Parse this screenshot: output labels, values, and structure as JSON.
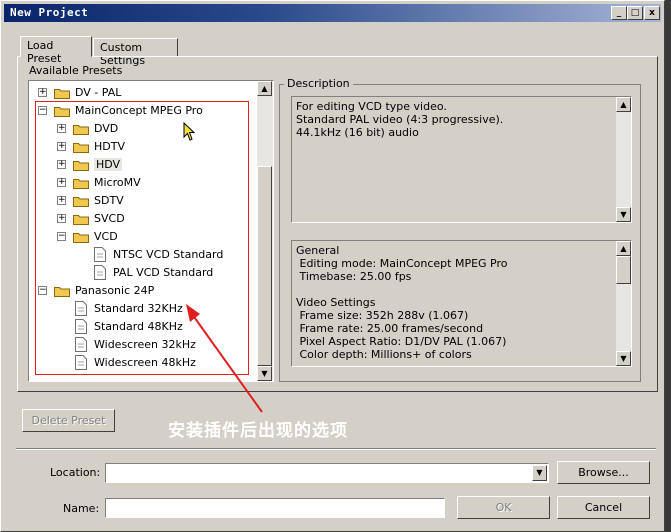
{
  "window": {
    "title": "New Project"
  },
  "title_buttons": {
    "minimize": "_",
    "maximize": "□",
    "close": "x"
  },
  "tabs": [
    {
      "label": "Load Preset"
    },
    {
      "label": "Custom Settings"
    }
  ],
  "available_presets_label": "Available Presets",
  "tree": [
    {
      "label": "DV - PAL",
      "type": "folder",
      "expander": "+"
    },
    {
      "label": "MainConcept MPEG Pro",
      "type": "folder",
      "expander": "−"
    },
    {
      "label": "DVD",
      "type": "folder",
      "expander": "+"
    },
    {
      "label": "HDTV",
      "type": "folder",
      "expander": "+"
    },
    {
      "label": "HDV",
      "type": "folder",
      "expander": "+",
      "highlighted": true
    },
    {
      "label": "MicroMV",
      "type": "folder",
      "expander": "+"
    },
    {
      "label": "SDTV",
      "type": "folder",
      "expander": "+"
    },
    {
      "label": "SVCD",
      "type": "folder",
      "expander": "+"
    },
    {
      "label": "VCD",
      "type": "folder",
      "expander": "−"
    },
    {
      "label": "NTSC VCD Standard",
      "type": "file"
    },
    {
      "label": "PAL VCD Standard",
      "type": "file"
    },
    {
      "label": "Panasonic 24P",
      "type": "folder",
      "expander": "−"
    },
    {
      "label": "Standard 32KHz",
      "type": "file"
    },
    {
      "label": "Standard 48KHz",
      "type": "file"
    },
    {
      "label": "Widescreen 32kHz",
      "type": "file"
    },
    {
      "label": "Widescreen 48kHz",
      "type": "file"
    }
  ],
  "description": {
    "legend": "Description",
    "lines": [
      "For editing VCD type video.",
      "Standard PAL video (4:3 progressive).",
      "44.1kHz (16 bit) audio"
    ]
  },
  "general": {
    "lines": [
      "General",
      " Editing mode: MainConcept MPEG Pro",
      " Timebase: 25.00 fps",
      "",
      "Video Settings",
      " Frame size: 352h 288v (1.067)",
      " Frame rate: 25.00 frames/second",
      " Pixel Aspect Ratio: D1/DV PAL (1.067)",
      " Color depth: Millions+ of colors"
    ]
  },
  "buttons": {
    "delete_preset": "Delete Preset",
    "browse": "Browse...",
    "ok": "OK",
    "cancel": "Cancel"
  },
  "fields": {
    "location_label": "Location:",
    "location_value": "",
    "name_label": "Name:",
    "name_value": ""
  },
  "annotation": {
    "text": "安装插件后出现的选项",
    "color": "#e02020"
  },
  "colors": {
    "title_start": "#0a246a",
    "title_end": "#a6b5d7",
    "folder": "#f0c850",
    "highlight_box": "#e02020"
  }
}
